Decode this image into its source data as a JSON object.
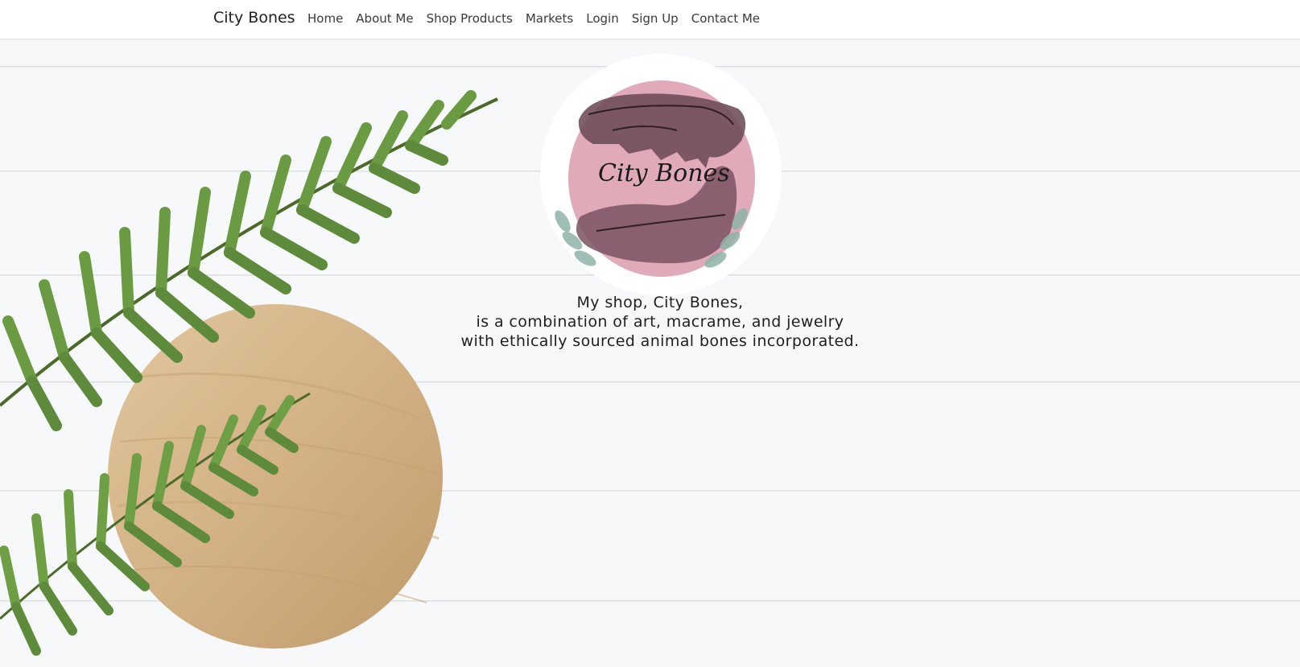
{
  "navbar": {
    "brand": "City Bones",
    "links": [
      {
        "label": "Home"
      },
      {
        "label": "About Me"
      },
      {
        "label": "Shop Products"
      },
      {
        "label": "Markets"
      },
      {
        "label": "Login"
      },
      {
        "label": "Sign Up"
      },
      {
        "label": "Contact Me"
      }
    ]
  },
  "hero": {
    "logo_text": "City Bones",
    "tagline": [
      "My shop, City Bones,",
      "is a combination of art, macrame, and jewelry",
      "with ethically sourced animal bones incorporated."
    ]
  },
  "colors": {
    "logo_pink": "#e1aab8",
    "fern_green": "#5e8a3c",
    "wood": "#d4b48a"
  },
  "icons": [
    "skull-illustration",
    "fern-leaf",
    "wooden-board"
  ]
}
